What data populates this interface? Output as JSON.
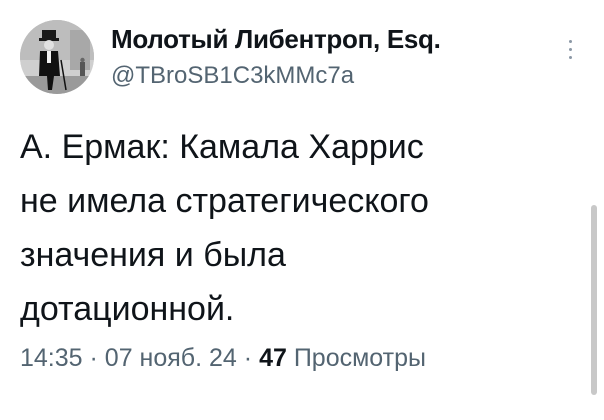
{
  "author": {
    "display_name": "Молотый Либентроп, Esq.",
    "handle": "@TBroSB1C3kMMc7a",
    "avatar_icon": "vintage-photo-avatar"
  },
  "tweet": {
    "lines": [
      "А. Ермак: Камала Харрис",
      "не имела стратегического",
      "значения и была",
      "дотационной."
    ]
  },
  "meta": {
    "time": "14:35",
    "separator": "·",
    "date": "07 нояб. 24",
    "views_count": "47",
    "views_label": "Просмотры"
  },
  "icons": {
    "more": "more-options-icon"
  },
  "colors": {
    "text": "#0f1419",
    "secondary": "#536471",
    "background": "#ffffff"
  }
}
